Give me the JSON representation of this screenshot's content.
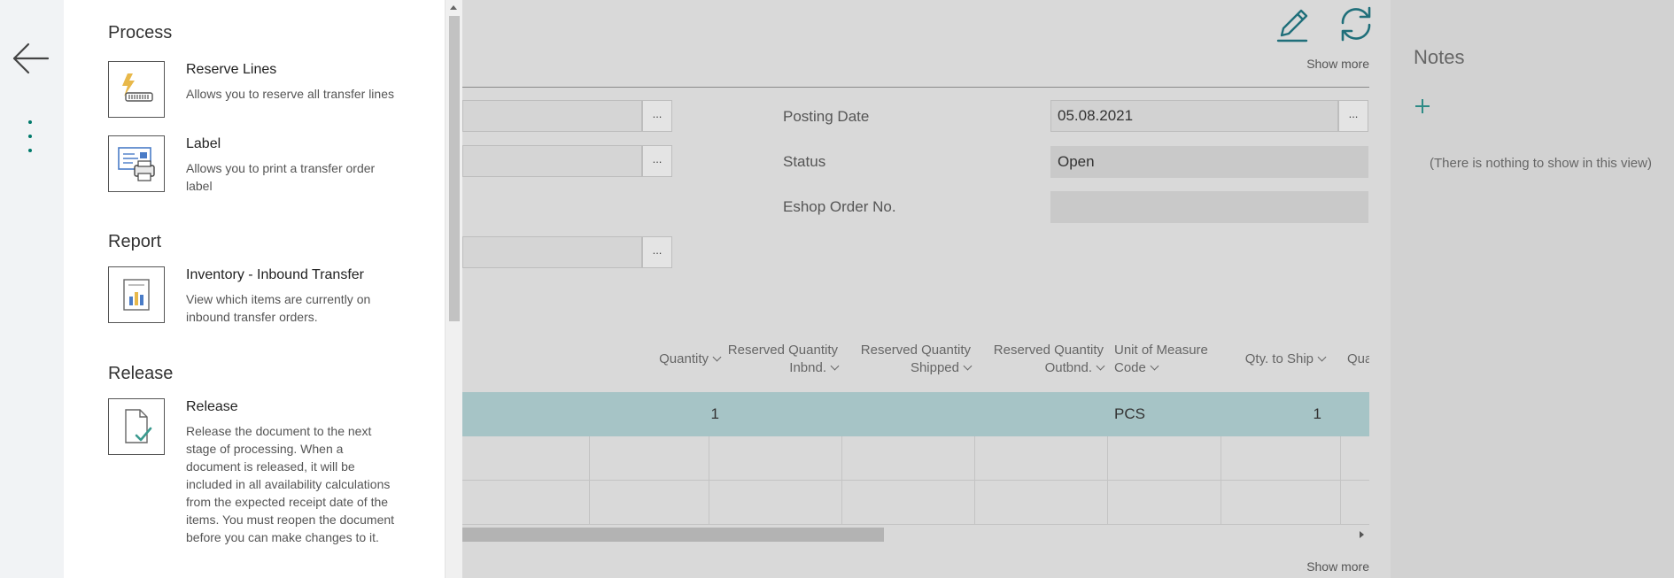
{
  "action_panel": {
    "sections": [
      {
        "title": "Process",
        "actions": [
          {
            "title": "Reserve Lines",
            "description": "Allows you to reserve all transfer lines",
            "icon": "reserve-lines-icon"
          },
          {
            "title": "Label",
            "description": "Allows you to print a transfer order label",
            "icon": "printer-label-icon"
          }
        ]
      },
      {
        "title": "Report",
        "actions": [
          {
            "title": "Inventory - Inbound Transfer",
            "description": "View which items are currently on inbound transfer orders.",
            "icon": "report-chart-icon"
          }
        ]
      },
      {
        "title": "Release",
        "actions": [
          {
            "title": "Release",
            "description": "Release the document to the next stage of processing. When a document is released, it will be included in all availability calculations from the expected receipt date of the items. You must reopen the document before you can make changes to it.",
            "icon": "release-document-icon"
          }
        ]
      }
    ]
  },
  "main": {
    "show_more_label": "Show more",
    "assist_label": "...",
    "fields": {
      "posting_date_label": "Posting Date",
      "posting_date_value": "05.08.2021",
      "status_label": "Status",
      "status_value": "Open",
      "eshop_order_label": "Eshop Order No.",
      "eshop_order_value": ""
    },
    "lines": {
      "columns": [
        {
          "line1": "",
          "line2": "Quantity"
        },
        {
          "line1": "Reserved Quantity",
          "line2": "Inbnd."
        },
        {
          "line1": "Reserved Quantity",
          "line2": "Shipped"
        },
        {
          "line1": "Reserved Quantity",
          "line2": "Outbnd."
        },
        {
          "line1": "Unit of Measure",
          "line2": "Code"
        },
        {
          "line1": "",
          "line2": "Qty. to Ship"
        },
        {
          "line1": "",
          "line2": "Qua"
        }
      ],
      "rows": [
        {
          "quantity": "1",
          "unit_of_measure": "PCS",
          "qty_to_ship": "1"
        }
      ]
    }
  },
  "notes": {
    "title": "Notes",
    "empty_text": "(There is nothing to show in this view)"
  },
  "colors": {
    "accent": "#00796b",
    "selected_row": "#a6c4c6",
    "overlay_gray": "#d9d9d9"
  }
}
